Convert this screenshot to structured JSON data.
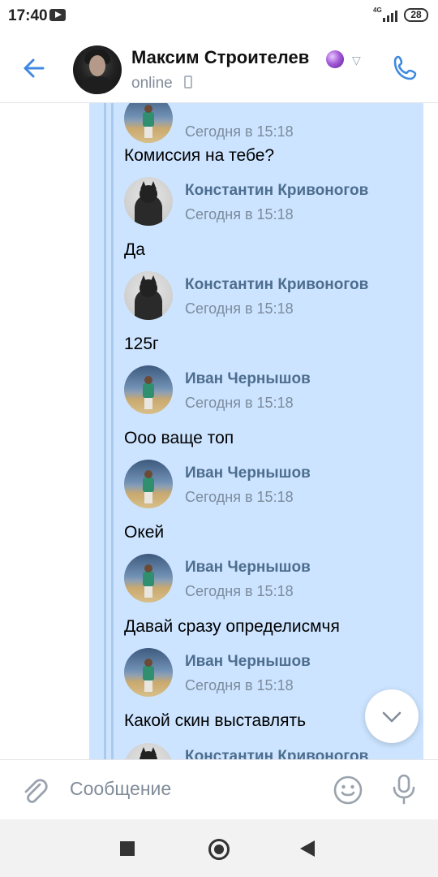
{
  "status_bar": {
    "time": "17:40",
    "network": "4G",
    "battery": "28"
  },
  "header": {
    "name": "Максим Строителев",
    "status": "online",
    "icons": [
      "back-arrow-icon",
      "crystal-ball-emoji",
      "chevron-down-icon",
      "mobile-phone-icon",
      "call-icon"
    ]
  },
  "messages": [
    {
      "author": "",
      "time": "Сегодня в 15:18",
      "text": "Комиссия на тебе?",
      "avatar": "ivan"
    },
    {
      "author": "Константин Кривоногов",
      "time": "Сегодня в 15:18",
      "text": "Да",
      "avatar": "kost"
    },
    {
      "author": "Константин Кривоногов",
      "time": "Сегодня в 15:18",
      "text": "125г",
      "avatar": "kost"
    },
    {
      "author": "Иван Чернышов",
      "time": "Сегодня в 15:18",
      "text": "Ооо ваще топ",
      "avatar": "ivan"
    },
    {
      "author": "Иван Чернышов",
      "time": "Сегодня в 15:18",
      "text": "Окей",
      "avatar": "ivan"
    },
    {
      "author": "Иван Чернышов",
      "time": "Сегодня в 15:18",
      "text": "Давай сразу определисмчя",
      "avatar": "ivan"
    },
    {
      "author": "Иван Чернышов",
      "time": "Сегодня в 15:18",
      "text": "Какой скин выставлять",
      "avatar": "ivan"
    },
    {
      "author": "Константин Кривоногов",
      "time": "",
      "text": "",
      "avatar": "kost"
    }
  ],
  "composer": {
    "placeholder": "Сообщение",
    "icons": [
      "attach-icon",
      "emoji-icon",
      "microphone-icon"
    ]
  },
  "colors": {
    "accent": "#3f8ae0",
    "bubble": "#cce4ff",
    "author": "#4d6d8f",
    "meta": "#7c8b9c"
  }
}
